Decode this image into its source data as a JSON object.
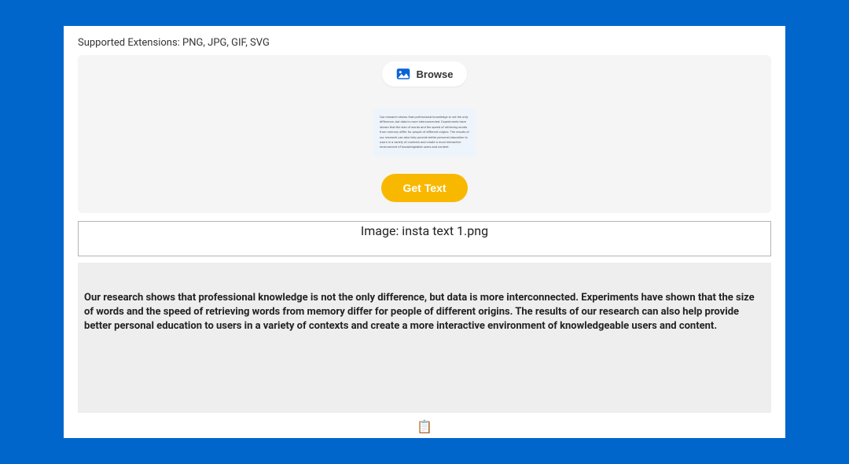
{
  "supported_label": "Supported Extensions: PNG, JPG, GIF, SVG",
  "browse_label": "Browse",
  "preview_text": "Our research shows that professional knowledge is not the only difference, but data is more interconnected. Experiments have shown that the size of words and the speed of retrieving words from memory differ for people of different origins. The results of our research can also help provide better personal education to users in a variety of contexts and create a more interactive environment of knowledgeable users and content.",
  "get_text_label": "Get Text",
  "filename_label": "Image: insta text 1.png",
  "result_text": "Our research shows that professional knowledge is not the only difference, but data is more interconnected. Experiments have shown that the size of words and the speed of retrieving words from memory differ for people of different origins. The results of our research can also help provide better personal education to users in a variety of contexts and create a more interactive environment of knowledgeable users and content.",
  "copy_glyph": "📋"
}
